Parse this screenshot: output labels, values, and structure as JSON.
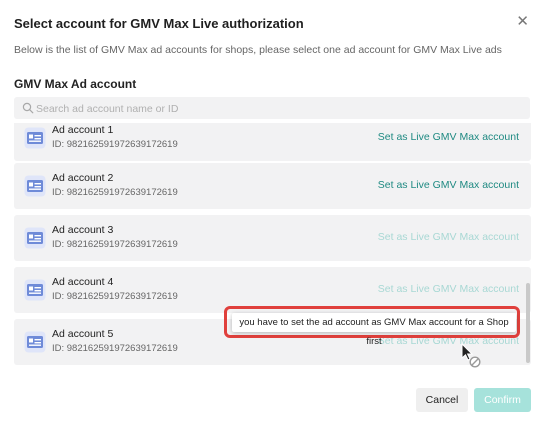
{
  "dialog": {
    "title": "Select account for GMV Max Live authorization",
    "subtitle": "Below is the list of GMV Max ad accounts for shops, please select one ad account for GMV Max Live ads",
    "section_title": "GMV Max Ad account"
  },
  "search": {
    "placeholder": "Search ad account name or ID",
    "value": ""
  },
  "accounts": [
    {
      "name": "Ad account 1",
      "id": "ID: 982162591972639172619",
      "action": "Set as Live GMV Max account",
      "enabled": true
    },
    {
      "name": "Ad account 2",
      "id": "ID: 982162591972639172619",
      "action": "Set as Live GMV Max account",
      "enabled": true
    },
    {
      "name": "Ad account 3",
      "id": "ID: 982162591972639172619",
      "action": "Set as Live GMV Max account",
      "enabled": false
    },
    {
      "name": "Ad account 4",
      "id": "ID: 982162591972639172619",
      "action": "Set as Live GMV Max account",
      "enabled": false
    },
    {
      "name": "Ad account 5",
      "id": "ID: 982162591972639172619",
      "action": "Set as Live GMV Max account",
      "enabled": false
    }
  ],
  "tooltip": {
    "text": "you have to set the ad account as GMV Max account for a Shop first"
  },
  "footer": {
    "cancel_label": "Cancel",
    "confirm_label": "Confirm"
  },
  "icons": {
    "close": "close-icon",
    "search": "search-icon",
    "account": "ad-account-card-icon",
    "cursor": "not-allowed-cursor-icon"
  },
  "colors": {
    "accent": "#1f8a82",
    "accent_disabled": "#a8d8d4",
    "confirm_disabled_bg": "#a6e2db",
    "highlight": "#e0403c",
    "row_bg": "#f2f2f3"
  }
}
